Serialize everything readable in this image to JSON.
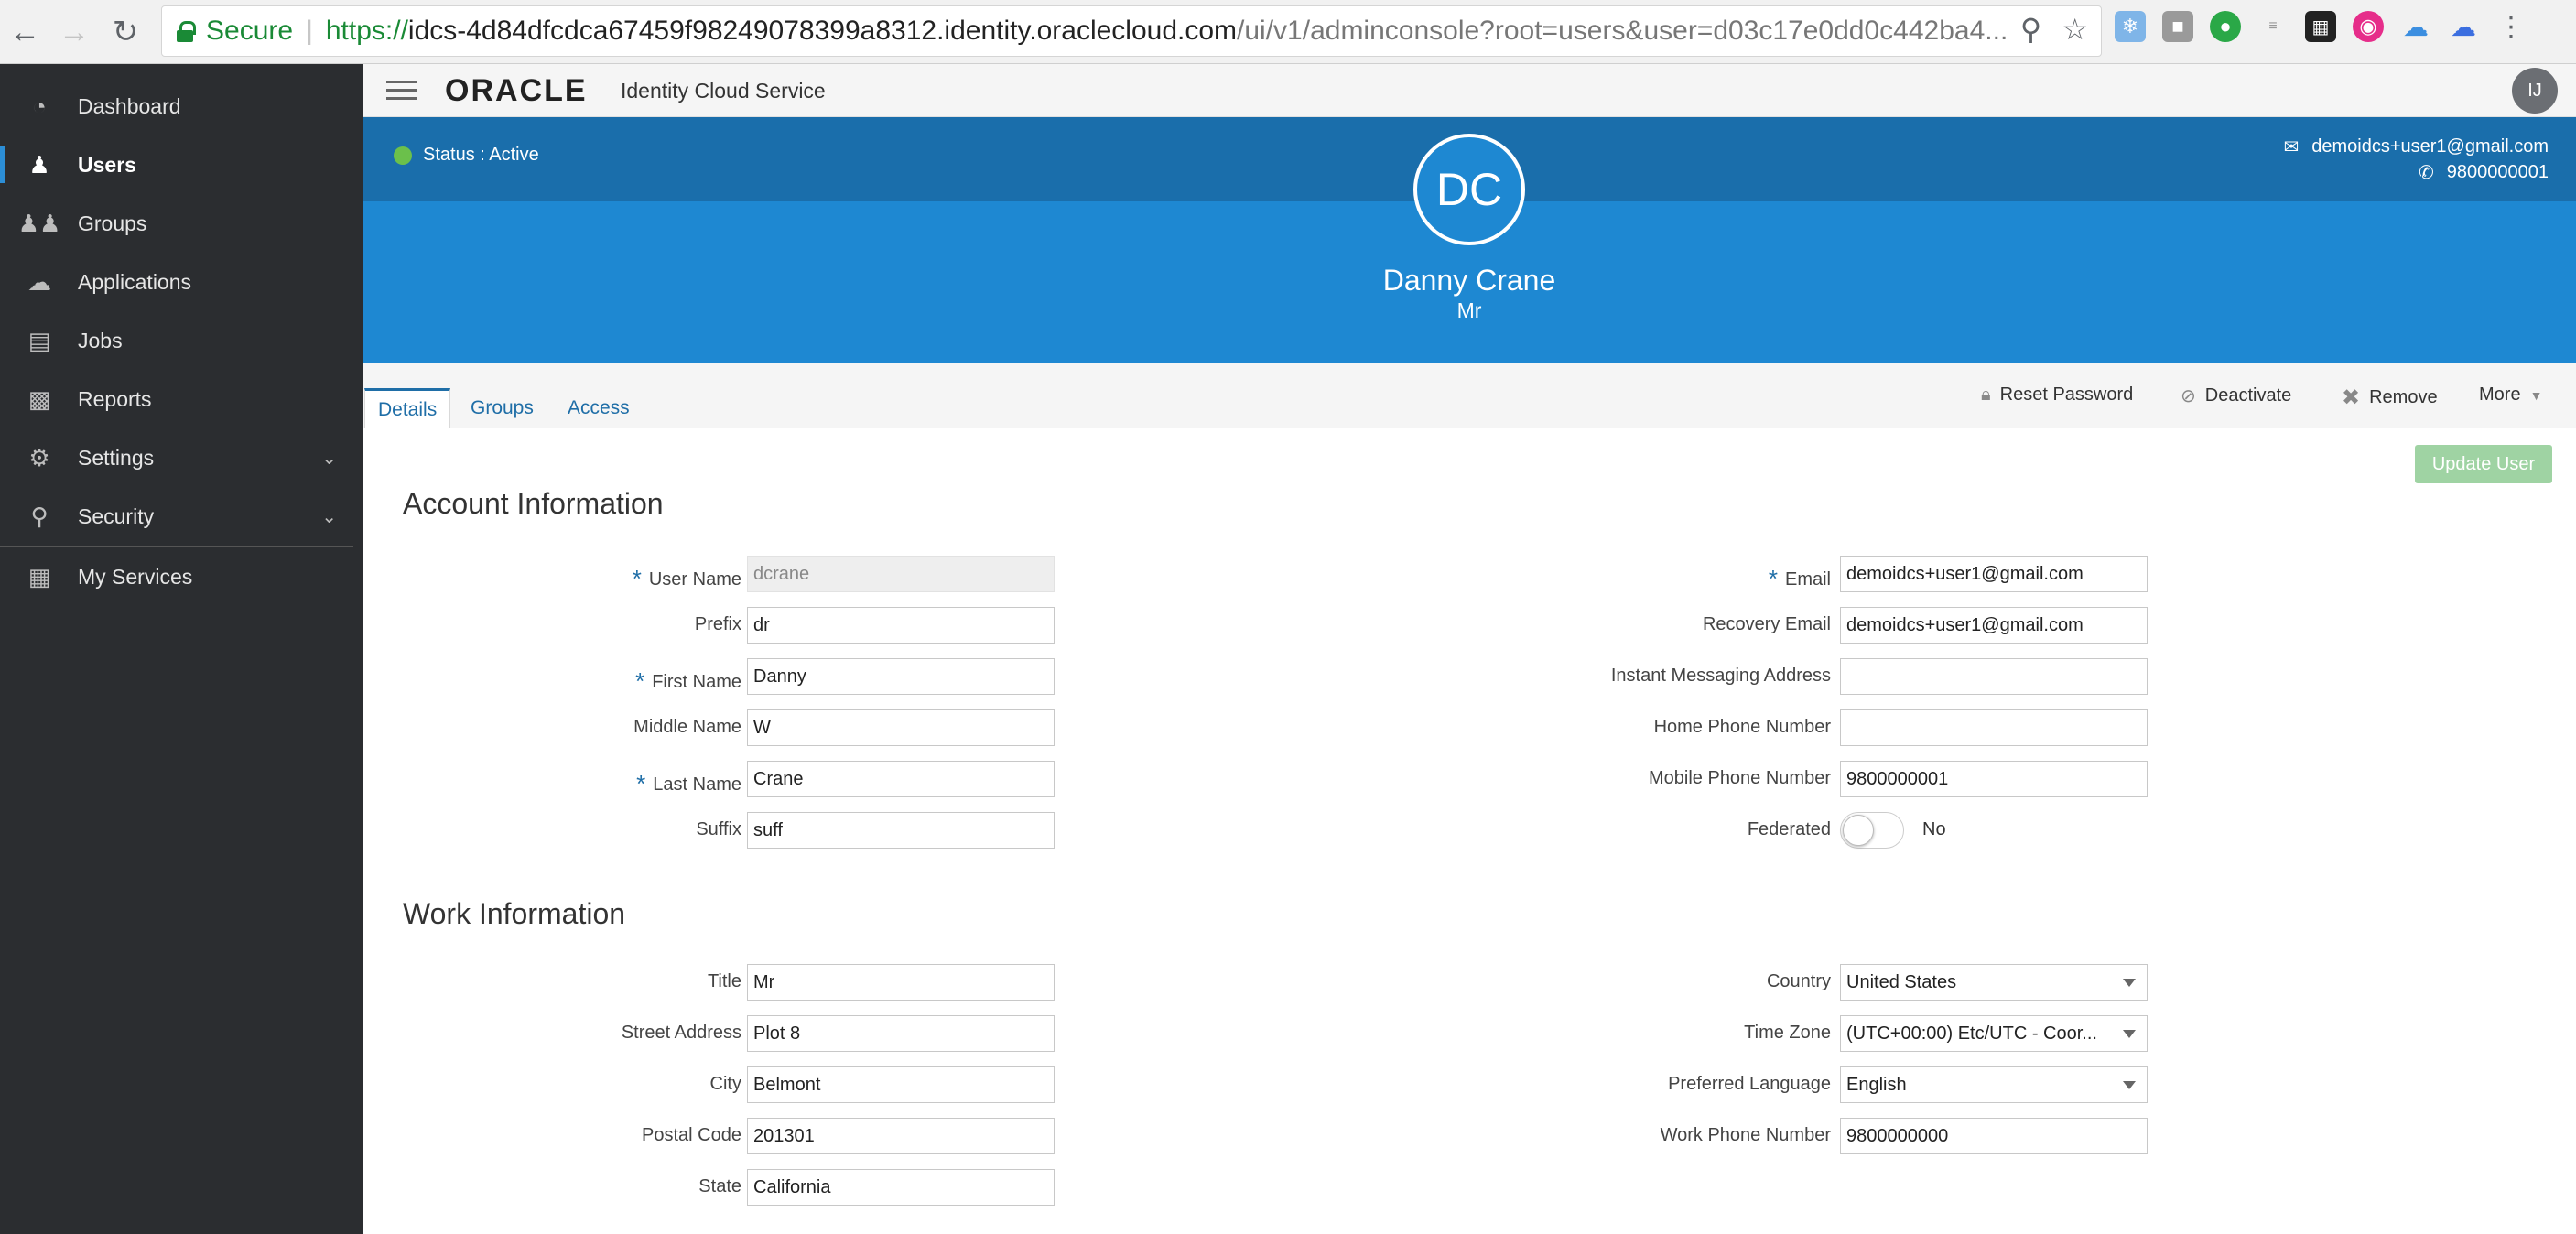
{
  "browser": {
    "secure_label": "Secure",
    "url_scheme": "https://",
    "url_host": "idcs-4d84dfcdca67459f98249078399a8312.identity.oraclecloud.com",
    "url_path": "/ui/v1/adminconsole?root=users&user=d03c17e0dd0c442ba4..."
  },
  "sidebar": {
    "items": [
      {
        "label": "Dashboard",
        "icon": "dashboard-icon"
      },
      {
        "label": "Users",
        "icon": "user-icon"
      },
      {
        "label": "Groups",
        "icon": "groups-icon"
      },
      {
        "label": "Applications",
        "icon": "cloud-icon"
      },
      {
        "label": "Jobs",
        "icon": "jobs-icon"
      },
      {
        "label": "Reports",
        "icon": "reports-icon"
      },
      {
        "label": "Settings",
        "icon": "gear-icon"
      },
      {
        "label": "Security",
        "icon": "key-icon"
      },
      {
        "label": "My Services",
        "icon": "grid-icon"
      }
    ],
    "active": "Users"
  },
  "header": {
    "logo": "ORACLE",
    "service_name": "Identity Cloud Service",
    "user_initials": "IJ"
  },
  "profile": {
    "status": "Status : Active",
    "email": "demoidcs+user1@gmail.com",
    "phone": "9800000001",
    "initials": "DC",
    "full_name": "Danny Crane",
    "title": "Mr"
  },
  "tabs": [
    "Details",
    "Groups",
    "Access"
  ],
  "actions": {
    "reset_password": "Reset Password",
    "deactivate": "Deactivate",
    "remove": "Remove",
    "more": "More",
    "update_user": "Update User"
  },
  "account": {
    "section_title": "Account Information",
    "user_name": {
      "label": "User Name",
      "value": "dcrane"
    },
    "prefix": {
      "label": "Prefix",
      "value": "dr"
    },
    "first_name": {
      "label": "First Name",
      "value": "Danny"
    },
    "middle_name": {
      "label": "Middle Name",
      "value": "W"
    },
    "last_name": {
      "label": "Last Name",
      "value": "Crane"
    },
    "suffix": {
      "label": "Suffix",
      "value": "suff"
    },
    "email": {
      "label": "Email",
      "value": "demoidcs+user1@gmail.com"
    },
    "recovery_email": {
      "label": "Recovery Email",
      "value": "demoidcs+user1@gmail.com"
    },
    "im_address": {
      "label": "Instant Messaging Address",
      "value": ""
    },
    "home_phone": {
      "label": "Home Phone Number",
      "value": ""
    },
    "mobile_phone": {
      "label": "Mobile Phone Number",
      "value": "9800000001"
    },
    "federated": {
      "label": "Federated",
      "value": "No"
    }
  },
  "work": {
    "section_title": "Work Information",
    "title": {
      "label": "Title",
      "value": "Mr"
    },
    "street": {
      "label": "Street Address",
      "value": "Plot 8"
    },
    "city": {
      "label": "City",
      "value": "Belmont"
    },
    "postal": {
      "label": "Postal Code",
      "value": "201301"
    },
    "state": {
      "label": "State",
      "value": "California"
    },
    "country": {
      "label": "Country",
      "value": "United States"
    },
    "time_zone": {
      "label": "Time Zone",
      "value": "(UTC+00:00) Etc/UTC - Coor..."
    },
    "language": {
      "label": "Preferred Language",
      "value": "English"
    },
    "work_phone": {
      "label": "Work Phone Number",
      "value": "9800000000"
    }
  },
  "colors": {
    "banner": "#1e88d2",
    "banner_top": "#1a6eab",
    "sidebar": "#2b2d30",
    "accent": "#1f6ea7",
    "status_active": "#6bc04b",
    "update_button": "#9fd3a3"
  }
}
